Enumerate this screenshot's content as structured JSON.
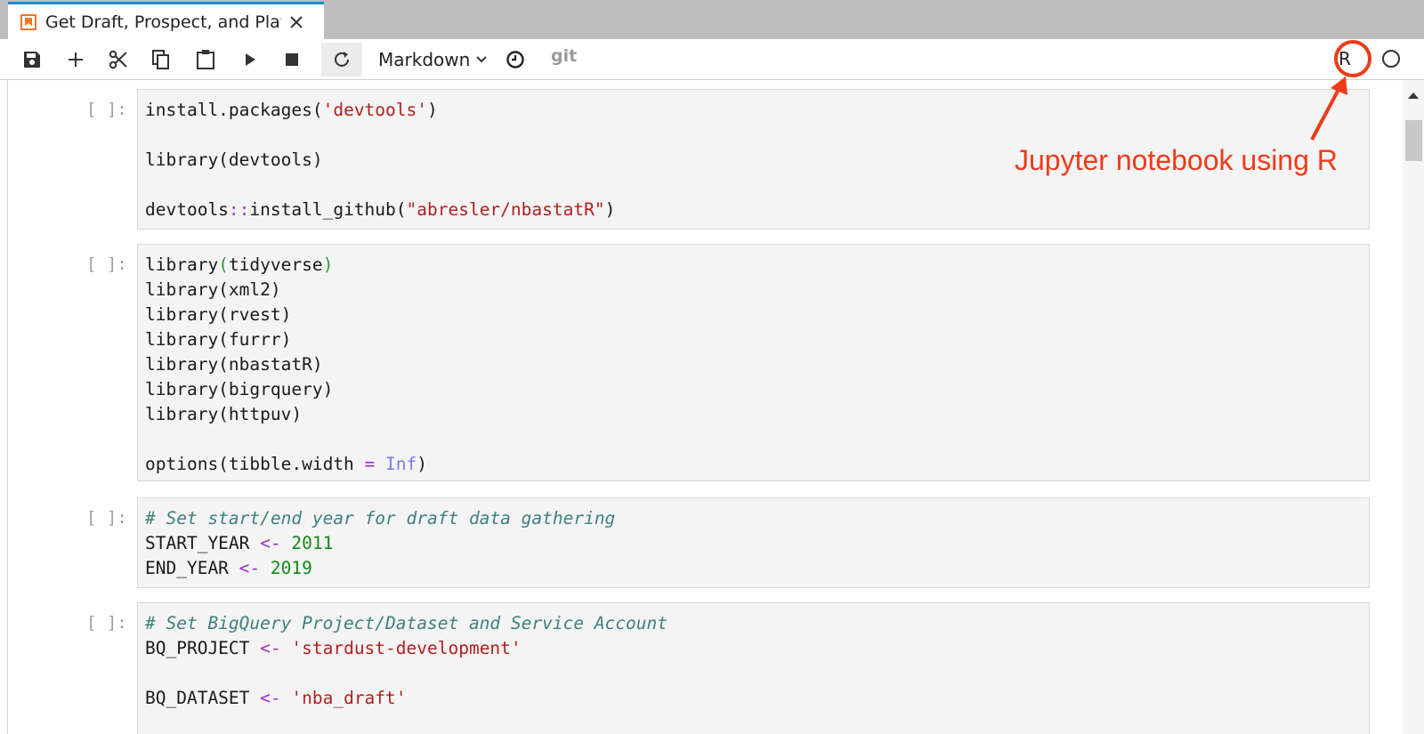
{
  "tab": {
    "title": "Get Draft, Prospect, and Player Data.ipynb"
  },
  "toolbar": {
    "cell_type": "Markdown",
    "git_label": "git",
    "kernel_name": "R"
  },
  "cells": [
    {
      "prompt": "[ ]:",
      "lines": [
        [
          {
            "t": "install.packages("
          },
          {
            "t": "'devtools'",
            "c": "str"
          },
          {
            "t": ")"
          }
        ],
        [],
        [
          {
            "t": "library(devtools)"
          }
        ],
        [],
        [
          {
            "t": "devtools"
          },
          {
            "t": "::",
            "c": "op"
          },
          {
            "t": "install_github("
          },
          {
            "t": "\"abresler/nbastatR\"",
            "c": "str"
          },
          {
            "t": ")"
          }
        ]
      ]
    },
    {
      "prompt": "[ ]:",
      "lines": [
        [
          {
            "t": "library"
          },
          {
            "t": "(",
            "c": "paren"
          },
          {
            "t": "tidyverse"
          },
          {
            "t": ")",
            "c": "paren"
          }
        ],
        [
          {
            "t": "library(xml2)"
          }
        ],
        [
          {
            "t": "library(rvest)"
          }
        ],
        [
          {
            "t": "library(furrr)"
          }
        ],
        [
          {
            "t": "library(nbastatR)"
          }
        ],
        [
          {
            "t": "library(bigrquery)"
          }
        ],
        [
          {
            "t": "library(httpuv)"
          }
        ],
        [],
        [
          {
            "t": "options(tibble.width "
          },
          {
            "t": "=",
            "c": "op"
          },
          {
            "t": " "
          },
          {
            "t": "Inf",
            "c": "kw"
          },
          {
            "t": ")"
          }
        ]
      ]
    },
    {
      "prompt": "[ ]:",
      "lines": [
        [
          {
            "t": "# Set start/end year for draft data gathering",
            "c": "comment"
          }
        ],
        [
          {
            "t": "START_YEAR "
          },
          {
            "t": "<-",
            "c": "op"
          },
          {
            "t": " "
          },
          {
            "t": "2011",
            "c": "num"
          }
        ],
        [
          {
            "t": "END_YEAR "
          },
          {
            "t": "<-",
            "c": "op"
          },
          {
            "t": " "
          },
          {
            "t": "2019",
            "c": "num"
          }
        ]
      ]
    },
    {
      "prompt": "[ ]:",
      "lines": [
        [
          {
            "t": "# Set BigQuery Project/Dataset and Service Account",
            "c": "comment"
          }
        ],
        [
          {
            "t": "BQ_PROJECT "
          },
          {
            "t": "<-",
            "c": "op"
          },
          {
            "t": " "
          },
          {
            "t": "'stardust-development'",
            "c": "str"
          }
        ],
        [],
        [
          {
            "t": "BQ_DATASET "
          },
          {
            "t": "<-",
            "c": "op"
          },
          {
            "t": " "
          },
          {
            "t": "'nba_draft'",
            "c": "str"
          }
        ]
      ]
    }
  ],
  "annotation": {
    "text": "Jupyter notebook using R",
    "color": "#ef3a1a"
  },
  "colors": {
    "tab_accent": "#1f8ad6",
    "tab_bar_bg": "#bdbdbd",
    "cell_bg": "#f4f4f4",
    "string": "#b21e1e",
    "operator": "#a22bd6",
    "number": "#138a13",
    "keyword": "#7a7ae8",
    "comment": "#3f7f7f"
  },
  "icons": {
    "tab": "notebook-icon",
    "toolbar": [
      "save-icon",
      "add-icon",
      "cut-icon",
      "copy-icon",
      "paste-icon",
      "run-icon",
      "stop-icon",
      "restart-icon",
      "chevron-down-icon",
      "clock-icon"
    ]
  }
}
